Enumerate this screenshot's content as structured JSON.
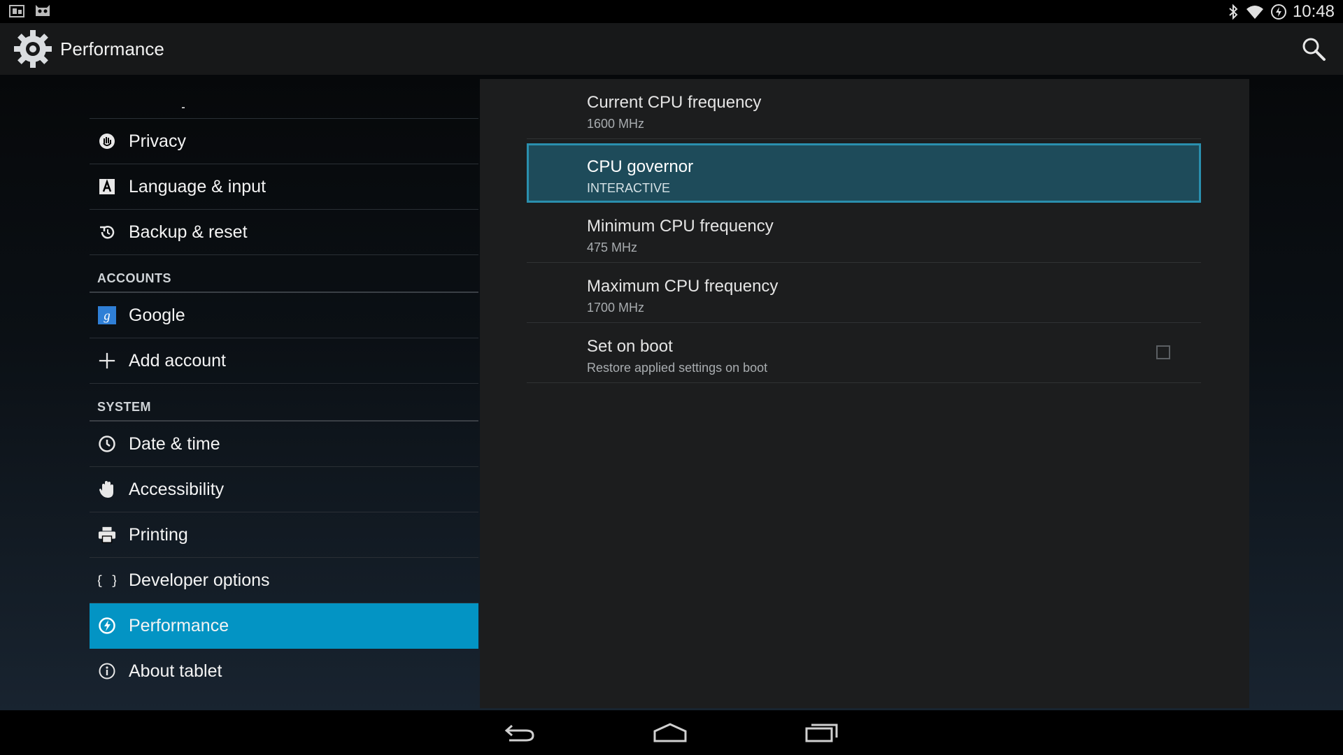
{
  "status_bar": {
    "time": "10:48",
    "icons": [
      "screenshot-icon",
      "cyanogen-icon",
      "bluetooth-icon",
      "wifi-icon",
      "battery-charging-icon"
    ]
  },
  "action_bar": {
    "title": "Performance"
  },
  "sidebar": {
    "items": [
      {
        "label": "Privacy",
        "icon": "privacy-icon"
      },
      {
        "label": "Language & input",
        "icon": "language-icon"
      },
      {
        "label": "Backup & reset",
        "icon": "backup-icon"
      }
    ],
    "accounts_header": "ACCOUNTS",
    "accounts": [
      {
        "label": "Google",
        "icon": "google-icon"
      },
      {
        "label": "Add account",
        "icon": "add-icon"
      }
    ],
    "system_header": "SYSTEM",
    "system": [
      {
        "label": "Date & time",
        "icon": "clock-icon"
      },
      {
        "label": "Accessibility",
        "icon": "hand-icon"
      },
      {
        "label": "Printing",
        "icon": "printer-icon"
      },
      {
        "label": "Developer options",
        "icon": "braces-icon"
      },
      {
        "label": "Performance",
        "icon": "performance-icon",
        "selected": true
      },
      {
        "label": "About tablet",
        "icon": "info-icon"
      }
    ]
  },
  "preferences": [
    {
      "title": "Current CPU frequency",
      "summary": "1600 MHz"
    },
    {
      "title": "CPU governor",
      "summary": "INTERACTIVE",
      "selected": true
    },
    {
      "title": "Minimum CPU frequency",
      "summary": "475 MHz"
    },
    {
      "title": "Maximum CPU frequency",
      "summary": "1700 MHz"
    },
    {
      "title": "Set on boot",
      "summary": "Restore applied settings on boot",
      "checked": false
    }
  ],
  "colors": {
    "accent": "#0394c4",
    "selected_pref_bg": "#1e4b5a",
    "selected_pref_border": "#2a8fae"
  }
}
